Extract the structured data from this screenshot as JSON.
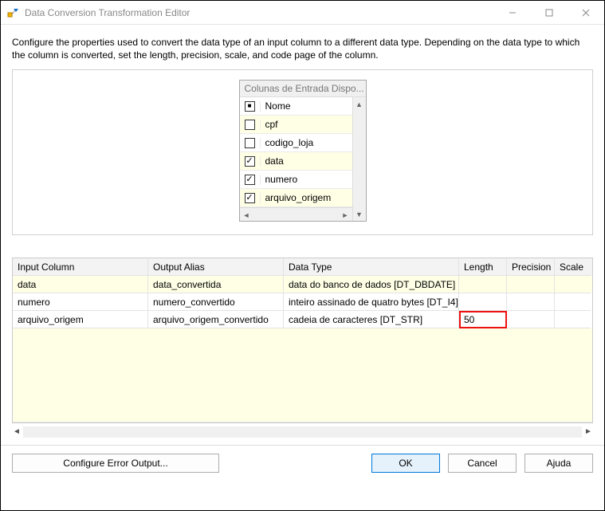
{
  "window": {
    "title": "Data Conversion Transformation Editor"
  },
  "description": "Configure the properties used to convert the data type of an input column to a different data type. Depending on the data type to which the column is converted, set the length, precision, scale, and code page of the column.",
  "listbox": {
    "title": "Colunas de Entrada Dispo...",
    "header_label": "Nome",
    "items": [
      {
        "label": "cpf",
        "checked": false
      },
      {
        "label": "codigo_loja",
        "checked": false
      },
      {
        "label": "data",
        "checked": true
      },
      {
        "label": "numero",
        "checked": true
      },
      {
        "label": "arquivo_origem",
        "checked": true
      }
    ]
  },
  "grid": {
    "headers": {
      "input": "Input Column",
      "alias": "Output Alias",
      "type": "Data Type",
      "length": "Length",
      "prec": "Precision",
      "scale": "Scale"
    },
    "rows": [
      {
        "input": "data",
        "alias": "data_convertida",
        "type": "data do banco de dados [DT_DBDATE]",
        "length": "",
        "prec": "",
        "scale": ""
      },
      {
        "input": "numero",
        "alias": "numero_convertido",
        "type": "inteiro assinado de quatro bytes [DT_I4]",
        "length": "",
        "prec": "",
        "scale": ""
      },
      {
        "input": "arquivo_origem",
        "alias": "arquivo_origem_convertido",
        "type": "cadeia de caracteres [DT_STR]",
        "length": "50",
        "prec": "",
        "scale": ""
      }
    ]
  },
  "buttons": {
    "configure": "Configure Error Output...",
    "ok": "OK",
    "cancel": "Cancel",
    "help": "Ajuda"
  }
}
